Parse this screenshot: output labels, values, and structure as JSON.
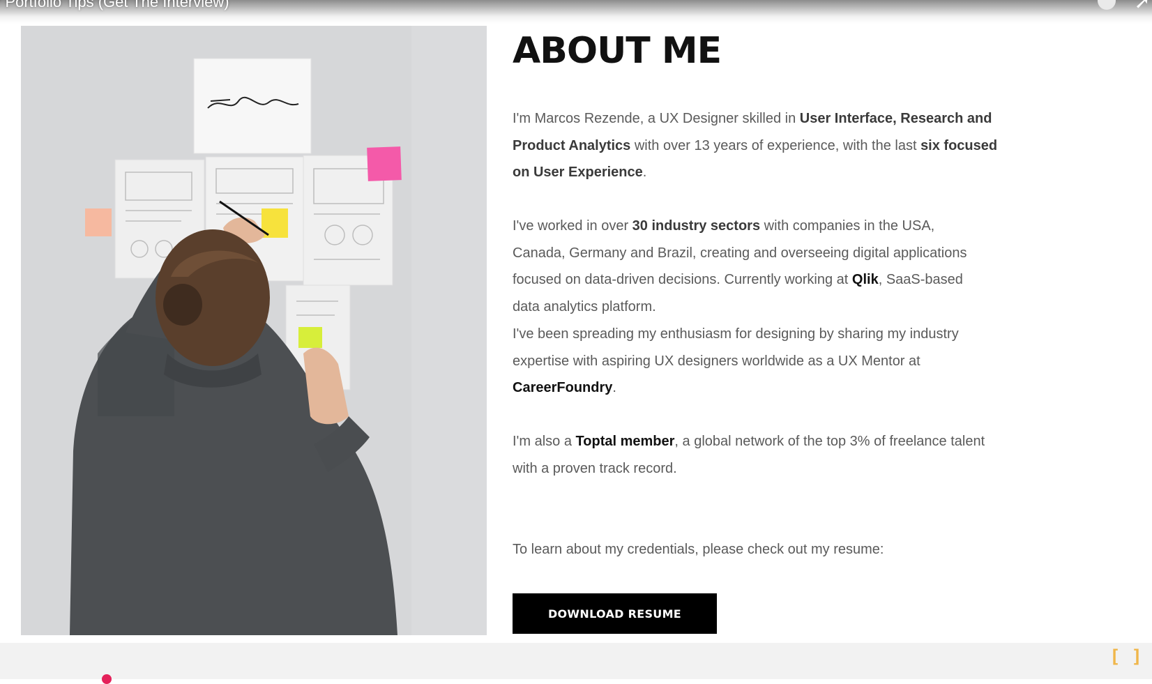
{
  "video": {
    "title": "r Portfolio Tips (Get The Interview)"
  },
  "photo": {
    "signature_text": "Features"
  },
  "about": {
    "heading": "ABOUT ME",
    "p1": {
      "t1": "I'm Marcos Rezende, a UX Designer skilled in ",
      "b1": "User Interface, Research and Product Analytics",
      "t2": " with over 13 years of experience, with the last ",
      "b2": "six focused on User Experience",
      "t3": "."
    },
    "p2": {
      "t1": "I've worked in over ",
      "b1": "30 industry sectors",
      "t2": " with companies in the USA, Canada, Germany and Brazil, creating and overseeing digital applications focused on data-driven decisions. Currently working at ",
      "b2": "Qlik",
      "t3": ", SaaS-based data analytics platform."
    },
    "p3": {
      "t1": "I've been spreading my enthusiasm for designing by sharing my industry expertise with aspiring UX designers worldwide as a UX Mentor at ",
      "b1": "CareerFoundry",
      "t2": "."
    },
    "p4": {
      "t1": "I'm also a ",
      "b1": "Toptal member",
      "t2": ", a global network of the top 3% of freelance talent with a proven track record."
    },
    "p5": {
      "t1": "To learn about my credentials, please check out my resume:"
    },
    "button_label": "DOWNLOAD RESUME"
  },
  "overlay": {
    "share_icon": "share-arrow-icon",
    "bracket_icon": "bracket-icon",
    "bracket_text": "[ ]"
  },
  "colors": {
    "button_bg": "#000000",
    "progress": "#e4215a",
    "bracket": "#f0b64a"
  }
}
